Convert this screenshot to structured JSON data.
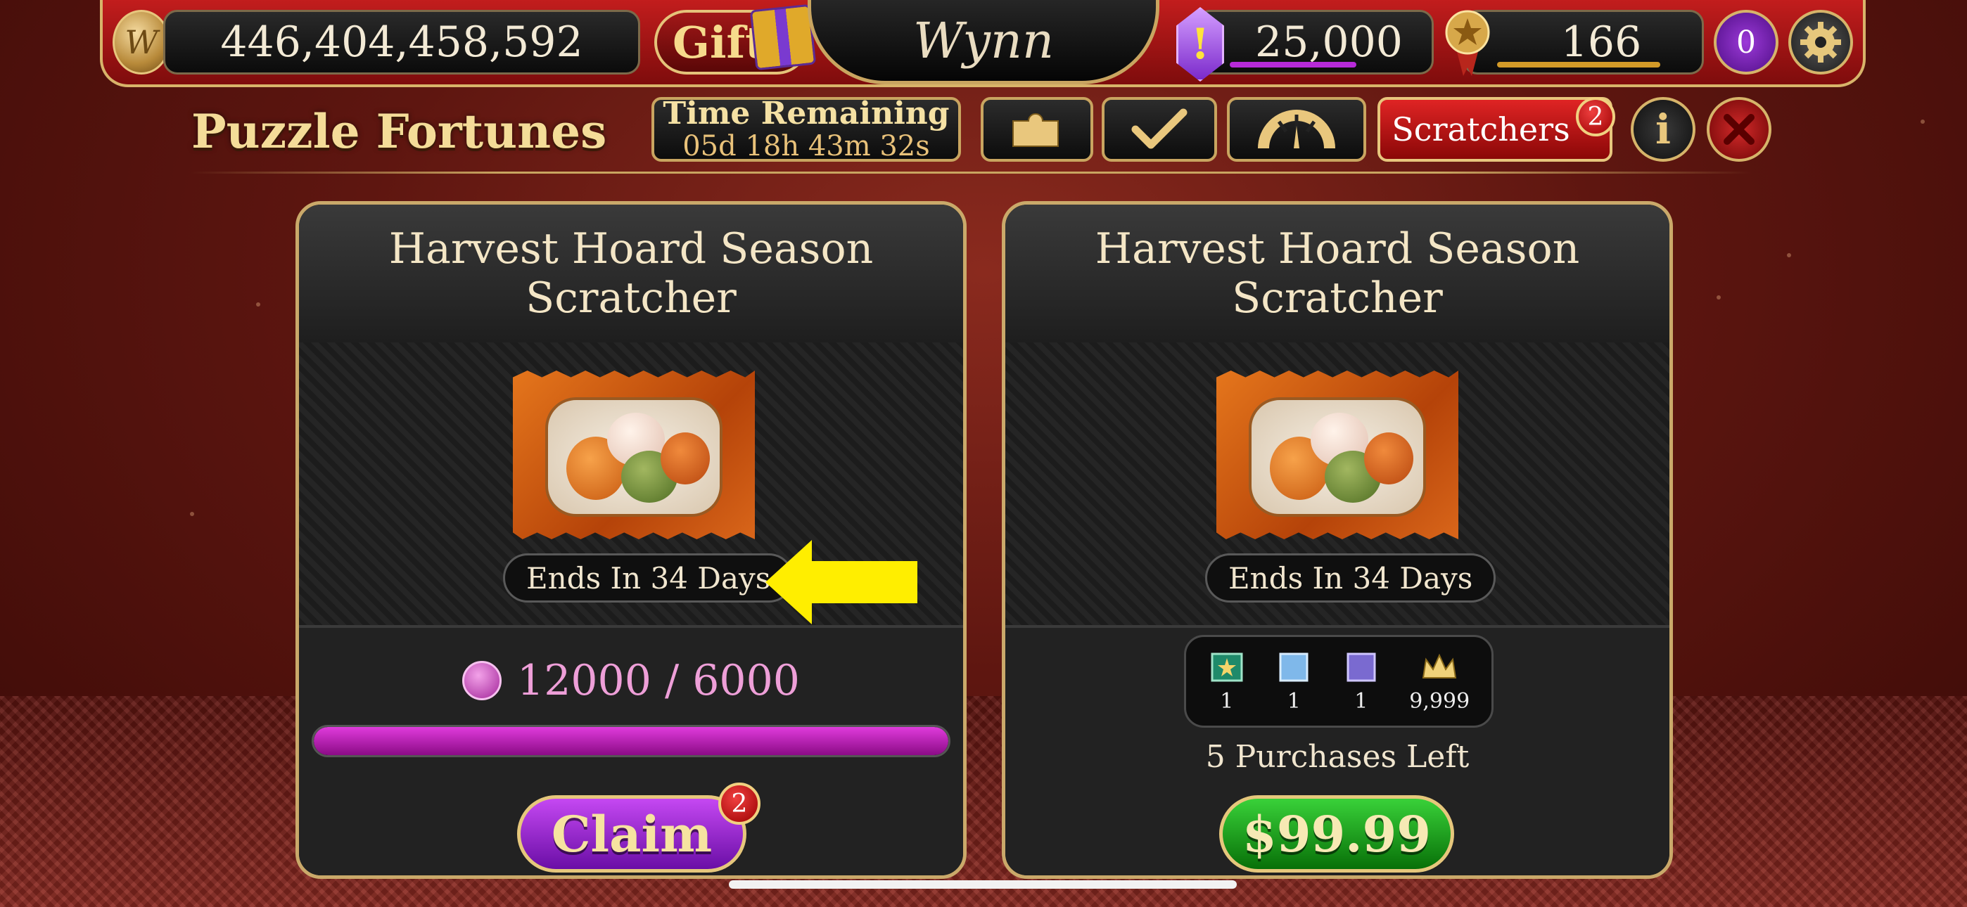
{
  "header": {
    "coins": "446,404,458,592",
    "gift_label": "Gift",
    "logo_text": "Wynn",
    "gems": "25,000",
    "level": "166",
    "vip_level": "0"
  },
  "subheader": {
    "title": "Puzzle Fortunes",
    "timer_label": "Time Remaining",
    "timer_value": "05d 18h 43m 32s",
    "scratchers_label": "Scratchers",
    "scratchers_badge": "2",
    "info_label": "i"
  },
  "cards": [
    {
      "title_line1": "Harvest Hoard Season",
      "title_line2": "Scratcher",
      "ends": "Ends In 34 Days",
      "progress_text": "12000 / 6000",
      "progress_fraction": 1.0,
      "claim_label": "Claim",
      "claim_badge": "2"
    },
    {
      "title_line1": "Harvest Hoard Season",
      "title_line2": "Scratcher",
      "ends": "Ends In 34 Days",
      "rewards": [
        {
          "icon": "green-ticket-icon",
          "count": "1"
        },
        {
          "icon": "blue-ticket-icon",
          "count": "1"
        },
        {
          "icon": "purple-ticket-icon",
          "count": "1"
        },
        {
          "icon": "crown-icon",
          "count": "9,999"
        }
      ],
      "purchases_left": "5 Purchases Left",
      "price": "$99.99"
    }
  ],
  "colors": {
    "accent_gold": "#c9a560",
    "header_red": "#c21d1d",
    "claim_purple": "#8b1fc9",
    "buy_green": "#1fae1f",
    "progress_magenta": "#c21bbd",
    "arrow_yellow": "#ffee00"
  }
}
